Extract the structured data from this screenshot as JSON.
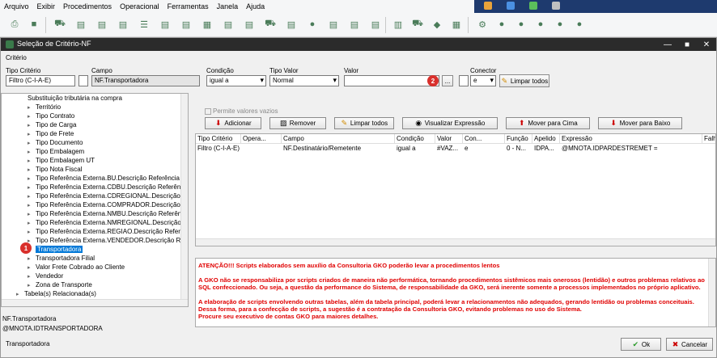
{
  "menu": [
    "Arquivo",
    "Exibir",
    "Procedimentos",
    "Operacional",
    "Ferramentas",
    "Janela",
    "Ajuda"
  ],
  "window": {
    "title": "Seleção de Critério-NF"
  },
  "criterio": {
    "group_label": "Critério",
    "tipo_criterio_label": "Tipo Critério",
    "tipo_criterio_value": "Filtro (C-I-A-E)",
    "campo_label": "Campo",
    "campo_value": "NF.Transportadora",
    "condicao_label": "Condição",
    "condicao_value": "igual a",
    "tipo_valor_label": "Tipo Valor",
    "tipo_valor_value": "Normal",
    "valor_label": "Valor",
    "valor_value": "",
    "ellipsis_label": "...",
    "conector_label": "Conector",
    "conector_value": "e",
    "limpar_todos_label": "Limpar todos"
  },
  "tree": {
    "items": [
      "Substituição tributária na compra",
      "Território",
      "Tipo Contrato",
      "Tipo de Carga",
      "Tipo de Frete",
      "Tipo Documento",
      "Tipo Embalagem",
      "Tipo Embalagem UT",
      "Tipo Nota Fiscal",
      "Tipo Referência Externa.BU.Descrição Referência",
      "Tipo Referência Externa.CDBU.Descrição Referênci",
      "Tipo Referência Externa.CDREGIONAL.Descrição R",
      "Tipo Referência Externa.COMPRADOR.Descrição R",
      "Tipo Referência Externa.NMBU.Descrição Referênci",
      "Tipo Referência Externa.NMREGIONAL.Descrição R",
      "Tipo Referência Externa.REGIAO.Descrição Referêr",
      "Tipo Referência Externa.VENDEDOR.Descrição Refe",
      "Transportadora",
      "Transportadora Filial",
      "Valor Frete Cobrado ao Cliente",
      "Vendedor",
      "Zona de Transporte",
      "Tabela(s) Relacionada(s)"
    ],
    "selected": "Transportadora"
  },
  "info": {
    "campo_name": "NF.Transportadora",
    "campo_expr": "@MNOTA.IDTRANSPORTADORA"
  },
  "actions": {
    "permite_vazios": "Permite valores vazios",
    "adicionar": "Adicionar",
    "remover": "Remover",
    "limpar_todos": "Limpar todos",
    "visualizar": "Visualizar Expressão",
    "mover_cima": "Mover para Cima",
    "mover_baixo": "Mover para Baixo"
  },
  "grid": {
    "headers": [
      "Tipo Critério",
      "Opera...",
      "Campo",
      "Condição",
      "Valor",
      "Con...",
      "Função",
      "Apelido",
      "Expressão",
      "Falh"
    ],
    "rows": [
      [
        "Filtro (C-I-A-E)",
        "",
        "NF.Destinatário/Remetente",
        "igual a",
        "#VAZ...",
        "e",
        "0 - N...",
        "IDPA...",
        "@MNOTA.IDPARDESTREMET =",
        ""
      ]
    ]
  },
  "warning": {
    "title": "ATENÇÃO!!! Scripts elaborados sem auxílio da Consultoria GKO poderão levar a procedimentos lentos",
    "p1": "A GKO não se responsabiliza por scripts criados de maneira não performática, tornando procedimentos sistêmicos mais onerosos (lentidão) e outros problemas relativos ao SQL confeccionado. Ou seja, a questão da performance do Sistema, de responsabilidade da GKO, será inerente somente a processos implementados no próprio aplicativo.",
    "p2": "A elaboração de scripts envolvendo outras tabelas, além da tabela principal, poderá levar a relacionamentos não adequados, gerando lentidão ou problemas conceituais. Dessa forma, para a confecção de scripts, a sugestão é a contratação da Consultoria GKO, evitando problemas no uso do Sistema.",
    "p3": "Procure seu executivo de contas GKO para maiores detalhes."
  },
  "footer": {
    "status": "Transportadora",
    "ok": "Ok",
    "cancelar": "Cancelar"
  },
  "badges": [
    "1",
    "2"
  ],
  "colors": {
    "accent": "#0078d7",
    "warning": "#e00000",
    "badge": "#d9302c",
    "titlebar": "#2b2b2b"
  }
}
